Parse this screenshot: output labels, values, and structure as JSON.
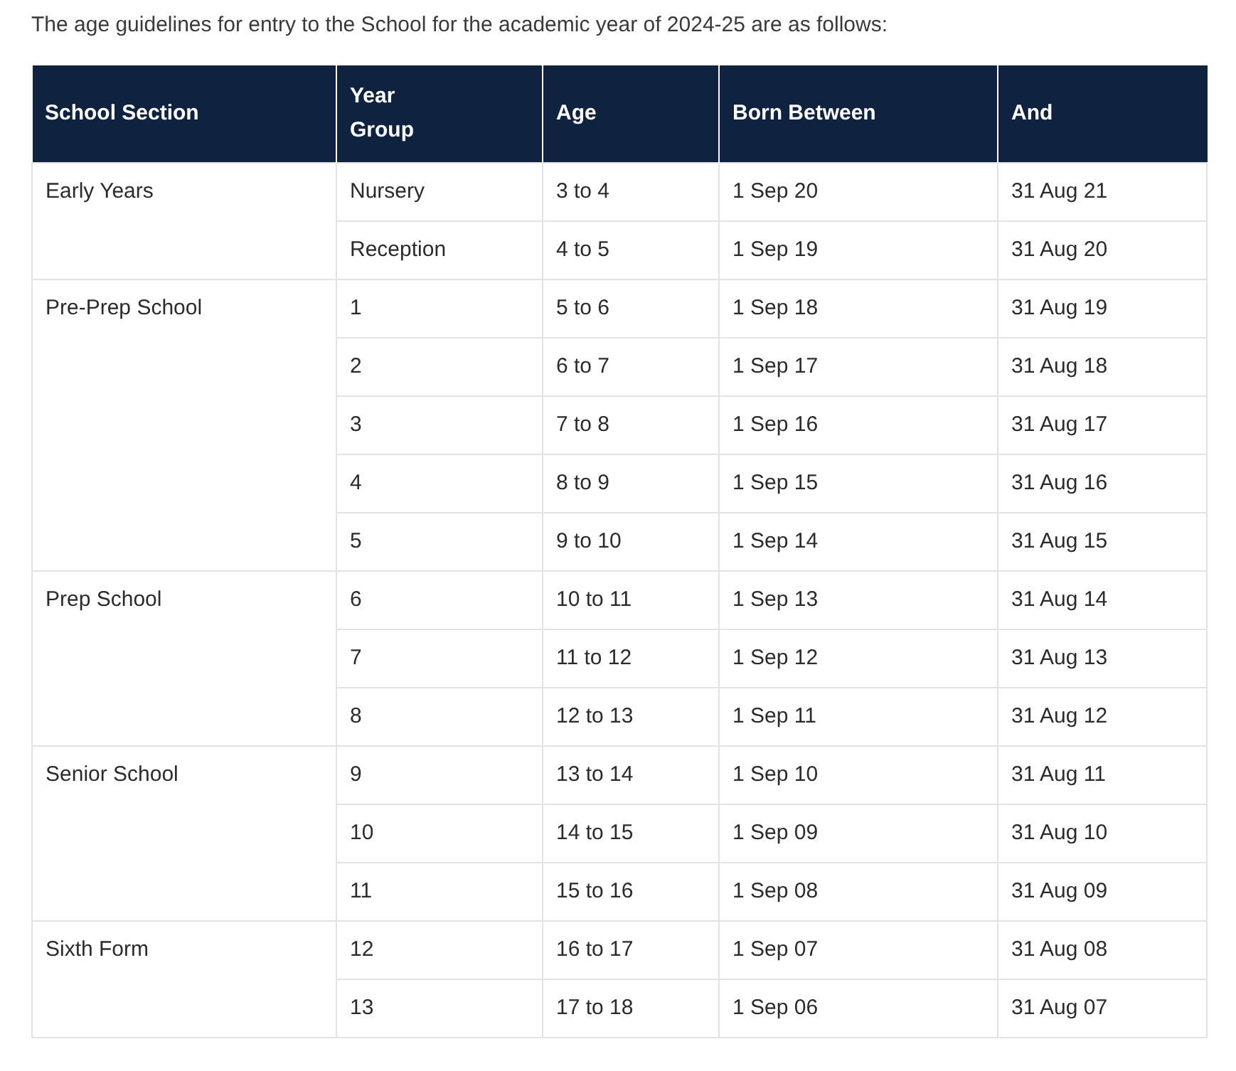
{
  "intro": "The age guidelines for entry to the School for the academic year of 2024-25 are as follows:",
  "table": {
    "columns": [
      "School Section",
      "Year Group",
      "Age",
      "Born Between",
      "And"
    ],
    "sections": [
      {
        "name": "Early Years",
        "rows": [
          [
            "Nursery",
            "3 to 4",
            "1 Sep 20",
            "31 Aug 21"
          ],
          [
            "Reception",
            "4 to 5",
            "1 Sep 19",
            "31 Aug 20"
          ]
        ]
      },
      {
        "name": "Pre-Prep School",
        "rows": [
          [
            "1",
            "5 to 6",
            "1 Sep 18",
            "31 Aug 19"
          ],
          [
            "2",
            "6 to 7",
            "1 Sep 17",
            "31 Aug 18"
          ],
          [
            "3",
            "7 to 8",
            "1 Sep 16",
            "31 Aug 17"
          ],
          [
            "4",
            "8 to 9",
            "1 Sep 15",
            "31 Aug 16"
          ],
          [
            "5",
            "9 to 10",
            "1 Sep 14",
            "31 Aug 15"
          ]
        ]
      },
      {
        "name": "Prep School",
        "rows": [
          [
            "6",
            "10 to 11",
            "1 Sep 13",
            "31 Aug 14"
          ],
          [
            "7",
            "11 to 12",
            "1 Sep 12",
            "31 Aug 13"
          ],
          [
            "8",
            "12 to 13",
            "1 Sep 11",
            "31 Aug 12"
          ]
        ]
      },
      {
        "name": "Senior School",
        "rows": [
          [
            "9",
            "13 to 14",
            "1 Sep 10",
            "31 Aug 11"
          ],
          [
            "10",
            "14 to 15",
            "1 Sep 09",
            "31 Aug 10"
          ],
          [
            "11",
            "15 to 16",
            "1 Sep 08",
            "31 Aug 09"
          ]
        ]
      },
      {
        "name": "Sixth Form",
        "rows": [
          [
            "12",
            "16 to 17",
            "1 Sep 07",
            "31 Aug 08"
          ],
          [
            "13",
            "17 to 18",
            "1 Sep 06",
            "31 Aug 07"
          ]
        ]
      }
    ]
  }
}
